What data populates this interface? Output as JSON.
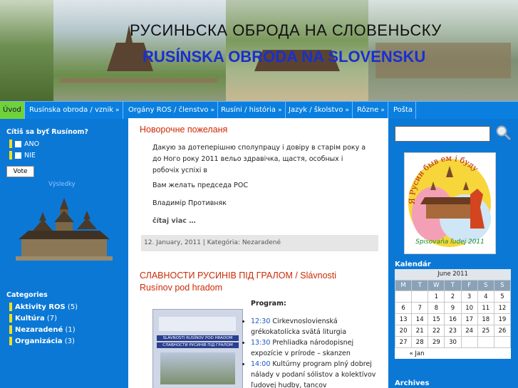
{
  "header": {
    "title_cyrillic": "РУСИНЬСКА ОБРОДА НА СЛОВЕНЬСКУ",
    "title_latin": "RUSÍNSKA OBRODA NA SLOVENSKU"
  },
  "nav": {
    "items": [
      {
        "label": "Úvod",
        "active": true,
        "has_dropdown": false
      },
      {
        "label": "Rusínska obroda / vznik",
        "active": false,
        "has_dropdown": true
      },
      {
        "label": "Orgány ROS / členstvo",
        "active": false,
        "has_dropdown": true
      },
      {
        "label": "Rusíni / história",
        "active": false,
        "has_dropdown": true
      },
      {
        "label": "Jazyk / školstvo",
        "active": false,
        "has_dropdown": true
      },
      {
        "label": "Rôzne",
        "active": false,
        "has_dropdown": true
      },
      {
        "label": "Pošta",
        "active": false,
        "has_dropdown": false
      }
    ],
    "dropdown_glyph": "»"
  },
  "poll": {
    "question": "Cítiš sa byť Rusínom?",
    "options": [
      "ANO",
      "NIE"
    ],
    "vote_label": "Vote",
    "results_label": "Výsledky"
  },
  "categories": {
    "heading": "Categories",
    "items": [
      {
        "name": "Aktivity ROS",
        "count": "(5)"
      },
      {
        "name": "Kultúra",
        "count": "(7)"
      },
      {
        "name": "Nezaradené",
        "count": "(1)"
      },
      {
        "name": "Organizácia",
        "count": "(3)"
      }
    ]
  },
  "posts": [
    {
      "title": "Новорочне пожеланя",
      "paragraphs": [
        "Дакую за дотеперішню сполупрацу і довіру в старім року а до Ного року 2011 вельо здравічка, щастя, особных і робочіх успіхі в",
        "Вам желать председа РОС",
        "Владимір Противняк"
      ],
      "read_more": "čítaj viac …",
      "meta": "12. January, 2011 | Kategória: Nezaradené"
    },
    {
      "title_line1": "СЛАВНОСТИ РУСИНІВ ПІД ГРАЛОМ / Slávnosti",
      "title_line2": "Rusínov pod hradom",
      "program_heading": "Program:",
      "program": [
        {
          "time": "12:30",
          "text": "Cirkevnoslovienská grékokatolícka svätá liturgia"
        },
        {
          "time": "13:30",
          "text": "Prehliadka národopisnej expozície v prírode – skanzen"
        },
        {
          "time": "14:00",
          "text": "Kultúrny program plný dobrej nálady v podaní sólistov a kolektívov ľudovej hudby, tancov"
        }
      ],
      "poster_lines": [
        "SLÁVNOSTI RUSÍNOV POD HRADOM",
        "СЛАВНОСТИ РУСИНІВ ПІД ГРАЛОМ"
      ]
    }
  ],
  "sidebar": {
    "badge_arc_text": "Я Русин быв ем і буду",
    "badge_caption": "Spisovaňa ľudej 2011",
    "calendar_heading": "Kalendár",
    "calendar": {
      "month": "June 2011",
      "weekdays": [
        "M",
        "T",
        "W",
        "T",
        "F",
        "S",
        "S"
      ],
      "weeks": [
        [
          "",
          "",
          "1",
          "2",
          "3",
          "4",
          "5"
        ],
        [
          "6",
          "7",
          "8",
          "9",
          "10",
          "11",
          "12"
        ],
        [
          "13",
          "14",
          "15",
          "16",
          "17",
          "18",
          "19"
        ],
        [
          "20",
          "21",
          "22",
          "23",
          "24",
          "25",
          "26"
        ],
        [
          "27",
          "28",
          "29",
          "30",
          "",
          "",
          ""
        ]
      ],
      "prev_link": "« Jan"
    },
    "archives_heading": "Archives"
  },
  "colors": {
    "page_bg": "#0b78d6",
    "nav_active": "#6fd23a",
    "post_title": "#cc2a05",
    "title_latin": "#1a2fd0",
    "accent_bar": "#f2e11a"
  }
}
